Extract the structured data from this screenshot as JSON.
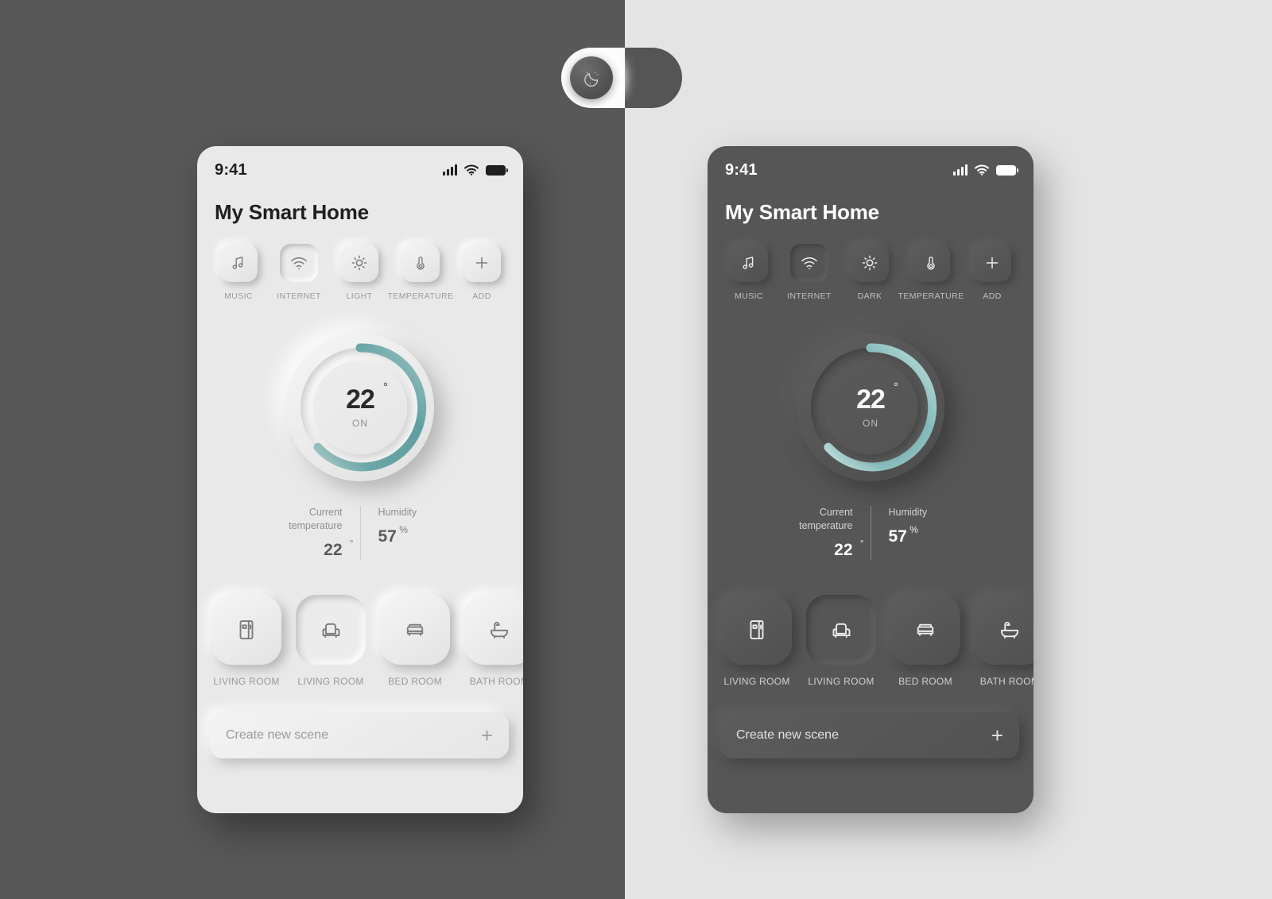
{
  "canvas": {
    "left_bg_color": "#585858",
    "right_bg_color": "#e4e4e4"
  },
  "theme_toggle": {
    "name": "dark-mode-toggle",
    "state": "on",
    "knob_icon": "moon-stars-icon",
    "track_left_color": "#fbfbfb",
    "track_right_color": "#555555"
  },
  "accent": {
    "arc_teal_light": "#5f9fa1",
    "arc_teal_dark": "#8fc3c2"
  },
  "light_phone": {
    "theme": "light",
    "status": {
      "time": "9:41",
      "signal_icon": "signal-bars-icon",
      "wifi_icon": "wifi-icon",
      "battery_icon": "battery-icon"
    },
    "title": "My Smart Home",
    "quick_actions": [
      {
        "label": "MUSIC",
        "icon": "music-note-icon",
        "pressed": false
      },
      {
        "label": "INTERNET",
        "icon": "wifi-icon",
        "pressed": true
      },
      {
        "label": "LIGHT",
        "icon": "sun-icon",
        "pressed": false
      },
      {
        "label": "TEMPERATURE",
        "icon": "thermometer-icon",
        "pressed": false
      },
      {
        "label": "ADD",
        "icon": "plus-icon",
        "pressed": false
      }
    ],
    "dial": {
      "value": "22",
      "degree_symbol": "°",
      "state": "ON",
      "arc_start_deg": 0,
      "arc_sweep_deg": 215
    },
    "stats": [
      {
        "label": "Current\ntemperature",
        "value": "22",
        "unit": "°"
      },
      {
        "label": "Humidity",
        "value": "57",
        "unit": "%"
      }
    ],
    "rooms": [
      {
        "label": "LIVING ROOM",
        "icon": "refrigerator-icon",
        "pressed": false
      },
      {
        "label": "LIVING ROOM",
        "icon": "armchair-icon",
        "pressed": true
      },
      {
        "label": "BED ROOM",
        "icon": "sofa-bed-icon",
        "pressed": false
      },
      {
        "label": "BATH ROOM",
        "icon": "bathtub-icon",
        "pressed": false
      }
    ],
    "scene": {
      "placeholder": "Create new scene",
      "value": "",
      "add_icon": "plus-icon"
    }
  },
  "dark_phone": {
    "theme": "dark",
    "status": {
      "time": "9:41",
      "signal_icon": "signal-bars-icon",
      "wifi_icon": "wifi-icon",
      "battery_icon": "battery-icon"
    },
    "title": "My Smart Home",
    "quick_actions": [
      {
        "label": "MUSIC",
        "icon": "music-note-icon",
        "pressed": false
      },
      {
        "label": "INTERNET",
        "icon": "wifi-icon",
        "pressed": true
      },
      {
        "label": "DARK",
        "icon": "sun-icon",
        "pressed": false
      },
      {
        "label": "TEMPERATURE",
        "icon": "thermometer-icon",
        "pressed": false
      },
      {
        "label": "ADD",
        "icon": "plus-icon",
        "pressed": false
      }
    ],
    "dial": {
      "value": "22",
      "degree_symbol": "°",
      "state": "ON",
      "arc_start_deg": 0,
      "arc_sweep_deg": 215
    },
    "stats": [
      {
        "label": "Current\ntemperature",
        "value": "22",
        "unit": "°"
      },
      {
        "label": "Humidity",
        "value": "57",
        "unit": "%"
      }
    ],
    "rooms": [
      {
        "label": "LIVING ROOM",
        "icon": "refrigerator-icon",
        "pressed": false
      },
      {
        "label": "LIVING ROOM",
        "icon": "armchair-icon",
        "pressed": true
      },
      {
        "label": "BED ROOM",
        "icon": "sofa-bed-icon",
        "pressed": false
      },
      {
        "label": "BATH ROOM",
        "icon": "bathtub-icon",
        "pressed": false
      }
    ],
    "scene": {
      "placeholder": "Create new scene",
      "value": "",
      "add_icon": "plus-icon"
    }
  }
}
